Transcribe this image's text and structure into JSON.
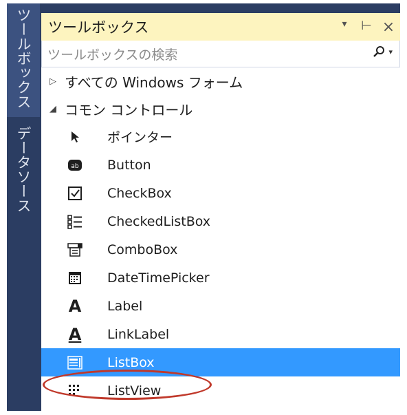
{
  "side_tabs": [
    {
      "label": "ツールボックス",
      "active": true
    },
    {
      "label": "データソース",
      "active": false
    }
  ],
  "panel": {
    "title": "ツールボックス",
    "controls": {
      "dropdown": "▾",
      "pin": "⊢",
      "close": "×"
    }
  },
  "search": {
    "placeholder": "ツールボックスの検索",
    "icon": "search-icon"
  },
  "groups": [
    {
      "label": "すべての Windows フォーム",
      "expanded": false
    },
    {
      "label": "コモン コントロール",
      "expanded": true
    }
  ],
  "items": [
    {
      "label": "ポインター",
      "icon": "pointer-icon"
    },
    {
      "label": "Button",
      "icon": "button-icon"
    },
    {
      "label": "CheckBox",
      "icon": "checkbox-icon"
    },
    {
      "label": "CheckedListBox",
      "icon": "checkedlistbox-icon"
    },
    {
      "label": "ComboBox",
      "icon": "combobox-icon"
    },
    {
      "label": "DateTimePicker",
      "icon": "datetimepicker-icon"
    },
    {
      "label": "Label",
      "icon": "label-icon"
    },
    {
      "label": "LinkLabel",
      "icon": "linklabel-icon"
    },
    {
      "label": "ListBox",
      "icon": "listbox-icon",
      "selected": true
    },
    {
      "label": "ListView",
      "icon": "listview-icon"
    }
  ],
  "colors": {
    "titlebar": "#fdf4bf",
    "selection": "#3399ff",
    "frame": "#2b3d62",
    "annotation": "#c0392b"
  }
}
